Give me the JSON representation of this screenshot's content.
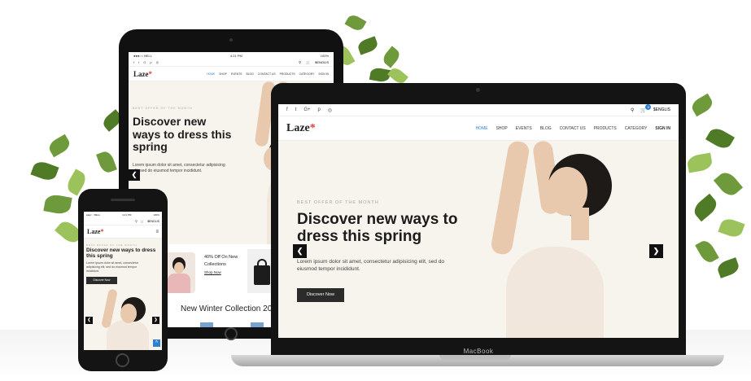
{
  "laptop": {
    "brand": "MacBook",
    "social_icons": [
      "f",
      "t",
      "G+",
      "p",
      "◎"
    ],
    "currency": "$ENGLIS",
    "cart_count": "0",
    "logo": "Laze",
    "menu": [
      "HOME",
      "SHOP",
      "EVENTS",
      "BLOG",
      "CONTACT US",
      "PRODUCTS",
      "CATEGORY",
      "SIGN IN"
    ],
    "eyebrow": "BEST OFFER OF THE MONTH",
    "headline_1": "Discover new ways to",
    "headline_2": "dress this spring",
    "body_1": "Lorem ipsum dolor sit amet, consectetur adipisicing elit, sed do",
    "body_2": "eiusmod tempor incididunt.",
    "button": "Discover Now",
    "prev_arrow": "❮",
    "next_arrow": "❯"
  },
  "tablet": {
    "carrier": "●●●○○ BELL",
    "time": "4:21 PM",
    "battery": "100%",
    "currency": "$ENGLIS",
    "logo": "Laze",
    "menu": [
      "HOME",
      "SHOP",
      "EVENTS",
      "BLOG",
      "CONTACT US",
      "PRODUCTS",
      "CATEGORY",
      "SIGN IN"
    ],
    "eyebrow": "BEST OFFER OF THE MONTH",
    "headline_1": "Discover new",
    "headline_2": "ways to dress this",
    "headline_3": "spring",
    "body_1": "Lorem ipsum dolor sit amet, consectetur adipisicing",
    "body_2": "elit, sed do eiusmod tempor incididunt.",
    "promo_1": "40% Off On New",
    "promo_2": "Collections",
    "promo_link": "Shop Now",
    "collection_title": "New Winter Collection 2018",
    "prev_arrow": "❮"
  },
  "phone": {
    "carrier": "●●●○○ BELL",
    "time": "4:21 PM",
    "battery": "100%",
    "currency": "$ENGLIS",
    "logo": "Laze",
    "eyebrow": "BEST OFFER OF THE MONTH",
    "headline_1": "Discover new ways to dress",
    "headline_2": "this spring",
    "body_1": "Lorem ipsum dolor sit amet, consectetur",
    "body_2": "adipisicing elit, sed do eiusmod tempor",
    "body_3": "incididunt.",
    "button": "Discover Now",
    "prev_arrow": "❮",
    "next_arrow": "❯",
    "scroll_top": "^"
  },
  "colors": {
    "accent": "#2f80d1",
    "logo_dot": "#e03a3a",
    "hero_bg": "#f7f3ed",
    "dark": "#2b2b2b"
  }
}
